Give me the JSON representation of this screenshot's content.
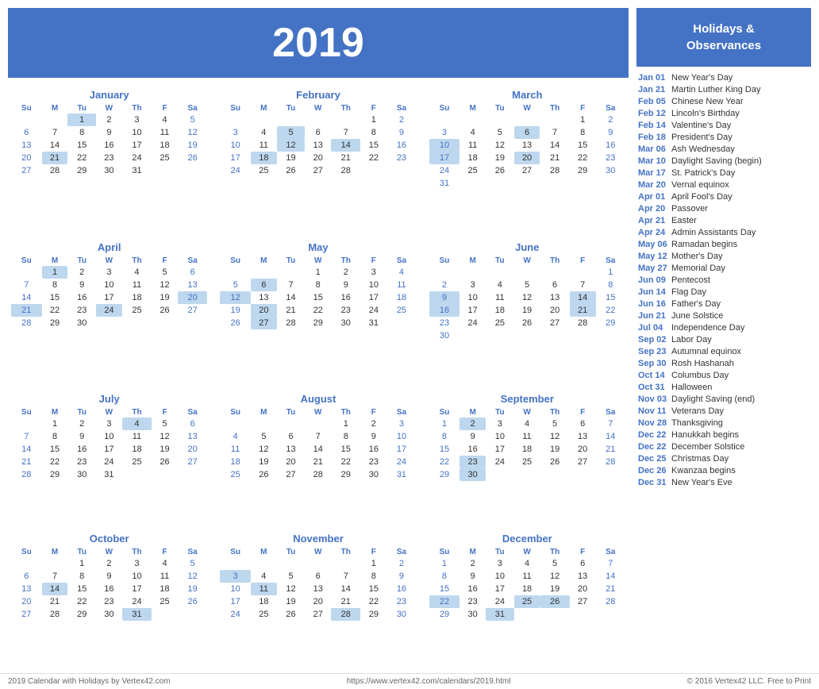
{
  "header": {
    "year": "2019",
    "bgColor": "#4472C4"
  },
  "months": [
    {
      "name": "January",
      "startDay": 2,
      "days": 31,
      "weeks": [
        [
          null,
          null,
          1,
          2,
          3,
          4,
          5
        ],
        [
          6,
          7,
          8,
          9,
          10,
          11,
          12
        ],
        [
          13,
          14,
          15,
          16,
          17,
          18,
          19
        ],
        [
          20,
          21,
          22,
          23,
          24,
          25,
          26
        ],
        [
          27,
          28,
          29,
          30,
          31,
          null,
          null
        ]
      ],
      "highlighted": [
        1,
        21
      ]
    },
    {
      "name": "February",
      "startDay": 5,
      "days": 28,
      "weeks": [
        [
          null,
          null,
          null,
          null,
          null,
          1,
          2
        ],
        [
          3,
          4,
          5,
          6,
          7,
          8,
          9
        ],
        [
          10,
          11,
          12,
          13,
          14,
          15,
          16
        ],
        [
          17,
          18,
          19,
          20,
          21,
          22,
          23
        ],
        [
          24,
          25,
          26,
          27,
          28,
          null,
          null
        ]
      ],
      "highlighted": [
        5,
        12,
        14,
        18
      ]
    },
    {
      "name": "March",
      "startDay": 5,
      "days": 31,
      "weeks": [
        [
          null,
          null,
          null,
          null,
          null,
          1,
          2
        ],
        [
          3,
          4,
          5,
          6,
          7,
          8,
          9
        ],
        [
          10,
          11,
          12,
          13,
          14,
          15,
          16
        ],
        [
          17,
          18,
          19,
          20,
          21,
          22,
          23
        ],
        [
          24,
          25,
          26,
          27,
          28,
          29,
          30
        ],
        [
          31,
          null,
          null,
          null,
          null,
          null,
          null
        ]
      ],
      "highlighted": [
        6,
        10,
        17,
        20
      ]
    },
    {
      "name": "April",
      "startDay": 1,
      "days": 30,
      "weeks": [
        [
          null,
          1,
          2,
          3,
          4,
          5,
          6
        ],
        [
          7,
          8,
          9,
          10,
          11,
          12,
          13
        ],
        [
          14,
          15,
          16,
          17,
          18,
          19,
          20
        ],
        [
          21,
          22,
          23,
          24,
          25,
          26,
          27
        ],
        [
          28,
          29,
          30,
          null,
          null,
          null,
          null
        ]
      ],
      "highlighted": [
        1,
        20,
        21,
        24
      ]
    },
    {
      "name": "May",
      "startDay": 3,
      "days": 31,
      "weeks": [
        [
          null,
          null,
          null,
          1,
          2,
          3,
          4
        ],
        [
          5,
          6,
          7,
          8,
          9,
          10,
          11
        ],
        [
          12,
          13,
          14,
          15,
          16,
          17,
          18
        ],
        [
          19,
          20,
          21,
          22,
          23,
          24,
          25
        ],
        [
          26,
          27,
          28,
          29,
          30,
          31,
          null
        ]
      ],
      "highlighted": [
        6,
        12,
        20,
        27
      ]
    },
    {
      "name": "June",
      "startDay": 6,
      "days": 30,
      "weeks": [
        [
          null,
          null,
          null,
          null,
          null,
          null,
          1
        ],
        [
          2,
          3,
          4,
          5,
          6,
          7,
          8
        ],
        [
          9,
          10,
          11,
          12,
          13,
          14,
          15
        ],
        [
          16,
          17,
          18,
          19,
          20,
          21,
          22
        ],
        [
          23,
          24,
          25,
          26,
          27,
          28,
          29
        ],
        [
          30,
          null,
          null,
          null,
          null,
          null,
          null
        ]
      ],
      "highlighted": [
        9,
        14,
        16,
        21
      ]
    },
    {
      "name": "July",
      "startDay": 1,
      "days": 31,
      "weeks": [
        [
          null,
          1,
          2,
          3,
          4,
          5,
          6
        ],
        [
          7,
          8,
          9,
          10,
          11,
          12,
          13
        ],
        [
          14,
          15,
          16,
          17,
          18,
          19,
          20
        ],
        [
          21,
          22,
          23,
          24,
          25,
          26,
          27
        ],
        [
          28,
          29,
          30,
          31,
          null,
          null,
          null
        ]
      ],
      "highlighted": [
        4
      ]
    },
    {
      "name": "August",
      "startDay": 4,
      "days": 31,
      "weeks": [
        [
          null,
          null,
          null,
          null,
          1,
          2,
          3
        ],
        [
          4,
          5,
          6,
          7,
          8,
          9,
          10
        ],
        [
          11,
          12,
          13,
          14,
          15,
          16,
          17
        ],
        [
          18,
          19,
          20,
          21,
          22,
          23,
          24
        ],
        [
          25,
          26,
          27,
          28,
          29,
          30,
          31
        ]
      ],
      "highlighted": []
    },
    {
      "name": "September",
      "startDay": 0,
      "days": 30,
      "weeks": [
        [
          1,
          2,
          3,
          4,
          5,
          6,
          7
        ],
        [
          8,
          9,
          10,
          11,
          12,
          13,
          14
        ],
        [
          15,
          16,
          17,
          18,
          19,
          20,
          21
        ],
        [
          22,
          23,
          24,
          25,
          26,
          27,
          28
        ],
        [
          29,
          30,
          null,
          null,
          null,
          null,
          null
        ]
      ],
      "highlighted": [
        2,
        23,
        30
      ]
    },
    {
      "name": "October",
      "startDay": 2,
      "days": 31,
      "weeks": [
        [
          null,
          null,
          1,
          2,
          3,
          4,
          5
        ],
        [
          6,
          7,
          8,
          9,
          10,
          11,
          12
        ],
        [
          13,
          14,
          15,
          16,
          17,
          18,
          19
        ],
        [
          20,
          21,
          22,
          23,
          24,
          25,
          26
        ],
        [
          27,
          28,
          29,
          30,
          31,
          null,
          null
        ]
      ],
      "highlighted": [
        14,
        31
      ]
    },
    {
      "name": "November",
      "startDay": 5,
      "days": 30,
      "weeks": [
        [
          null,
          null,
          null,
          null,
          null,
          1,
          2
        ],
        [
          3,
          4,
          5,
          6,
          7,
          8,
          9
        ],
        [
          10,
          11,
          12,
          13,
          14,
          15,
          16
        ],
        [
          17,
          18,
          19,
          20,
          21,
          22,
          23
        ],
        [
          24,
          25,
          26,
          27,
          28,
          29,
          30
        ]
      ],
      "highlighted": [
        3,
        11,
        28
      ]
    },
    {
      "name": "December",
      "startDay": 0,
      "days": 31,
      "weeks": [
        [
          1,
          2,
          3,
          4,
          5,
          6,
          7
        ],
        [
          8,
          9,
          10,
          11,
          12,
          13,
          14
        ],
        [
          15,
          16,
          17,
          18,
          19,
          20,
          21
        ],
        [
          22,
          23,
          24,
          25,
          26,
          27,
          28
        ],
        [
          29,
          30,
          31,
          null,
          null,
          null,
          null
        ]
      ],
      "highlighted": [
        22,
        25,
        26,
        31
      ]
    }
  ],
  "sidebar": {
    "title": "Holidays &\nObservances",
    "holidays": [
      {
        "date": "Jan 01",
        "name": "New Year's Day"
      },
      {
        "date": "Jan 21",
        "name": "Martin Luther King Day"
      },
      {
        "date": "Feb 05",
        "name": "Chinese New Year"
      },
      {
        "date": "Feb 12",
        "name": "Lincoln's Birthday"
      },
      {
        "date": "Feb 14",
        "name": "Valentine's Day"
      },
      {
        "date": "Feb 18",
        "name": "President's Day"
      },
      {
        "date": "Mar 06",
        "name": "Ash Wednesday"
      },
      {
        "date": "Mar 10",
        "name": "Daylight Saving (begin)"
      },
      {
        "date": "Mar 17",
        "name": "St. Patrick's Day"
      },
      {
        "date": "Mar 20",
        "name": "Vernal equinox"
      },
      {
        "date": "Apr 01",
        "name": "April Fool's Day"
      },
      {
        "date": "Apr 20",
        "name": "Passover"
      },
      {
        "date": "Apr 21",
        "name": "Easter"
      },
      {
        "date": "Apr 24",
        "name": "Admin Assistants Day"
      },
      {
        "date": "May 06",
        "name": "Ramadan begins"
      },
      {
        "date": "May 12",
        "name": "Mother's Day"
      },
      {
        "date": "May 27",
        "name": "Memorial Day"
      },
      {
        "date": "Jun 09",
        "name": "Pentecost"
      },
      {
        "date": "Jun 14",
        "name": "Flag Day"
      },
      {
        "date": "Jun 16",
        "name": "Father's Day"
      },
      {
        "date": "Jun 21",
        "name": "June Solstice"
      },
      {
        "date": "Jul 04",
        "name": "Independence Day"
      },
      {
        "date": "Sep 02",
        "name": "Labor Day"
      },
      {
        "date": "Sep 23",
        "name": "Autumnal equinox"
      },
      {
        "date": "Sep 30",
        "name": "Rosh Hashanah"
      },
      {
        "date": "Oct 14",
        "name": "Columbus Day"
      },
      {
        "date": "Oct 31",
        "name": "Halloween"
      },
      {
        "date": "Nov 03",
        "name": "Daylight Saving (end)"
      },
      {
        "date": "Nov 11",
        "name": "Veterans Day"
      },
      {
        "date": "Nov 28",
        "name": "Thanksgiving"
      },
      {
        "date": "Dec 22",
        "name": "Hanukkah begins"
      },
      {
        "date": "Dec 22",
        "name": "December Solstice"
      },
      {
        "date": "Dec 25",
        "name": "Christmas Day"
      },
      {
        "date": "Dec 26",
        "name": "Kwanzaa begins"
      },
      {
        "date": "Dec 31",
        "name": "New Year's Eve"
      }
    ]
  },
  "footer": {
    "left": "2019 Calendar with Holidays by Vertex42.com",
    "center": "https://www.vertex42.com/calendars/2019.html",
    "right": "© 2016 Vertex42 LLC. Free to Print"
  },
  "days_header": [
    "Su",
    "M",
    "Tu",
    "W",
    "Th",
    "F",
    "Sa"
  ]
}
